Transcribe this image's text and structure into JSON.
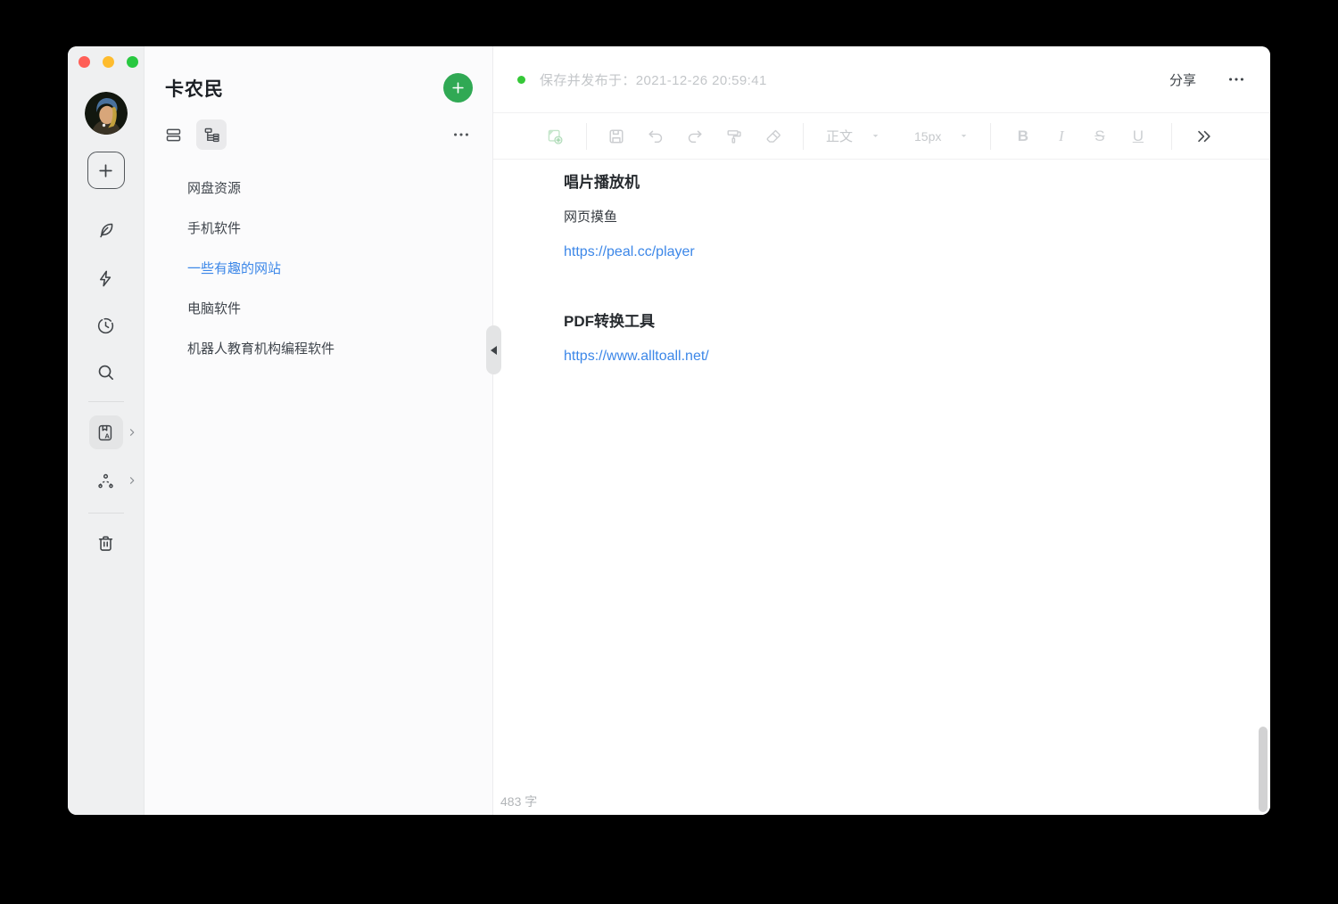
{
  "window": {
    "traffic_colors": {
      "close": "#ff5f57",
      "minimize": "#febc2e",
      "zoom": "#28c840"
    }
  },
  "icon_rail": {
    "icons": [
      {
        "name": "avatar"
      },
      {
        "name": "new-note-icon"
      },
      {
        "name": "pen-icon"
      },
      {
        "name": "flash-icon"
      },
      {
        "name": "recent-icon"
      },
      {
        "name": "search-icon"
      },
      {
        "name": "knowledge-base-icon"
      },
      {
        "name": "team-icon"
      },
      {
        "name": "trash-icon"
      }
    ]
  },
  "doc_sidebar": {
    "title": "卡农民",
    "view_toggles": [
      {
        "name": "list-view",
        "selected": false
      },
      {
        "name": "tree-view",
        "selected": true
      }
    ],
    "items": [
      {
        "label": "网盘资源",
        "active": false
      },
      {
        "label": "手机软件",
        "active": false
      },
      {
        "label": "一些有趣的网站",
        "active": true
      },
      {
        "label": "电脑软件",
        "active": false
      },
      {
        "label": "机器人教育机构编程软件",
        "active": false
      }
    ]
  },
  "editor_header": {
    "status_text": "保存并发布于：2021-12-26 20:59:41",
    "share_label": "分享"
  },
  "toolbar": {
    "paragraph_style": "正文",
    "font_size": "15px",
    "bold_label": "B",
    "italic_label": "I",
    "strike_label": "S",
    "underline_label": "U"
  },
  "content": {
    "heading1": "唱片播放机",
    "para1": "网页摸鱼",
    "link1": "https://peal.cc/player",
    "heading2": "PDF转换工具",
    "link2": "https://www.alltoall.net/"
  },
  "footer": {
    "word_count": "483 字"
  },
  "colors": {
    "accent_green": "#30a954",
    "saved_dot_green": "#35c838",
    "link_blue": "#3c87e8",
    "active_item_blue": "#3c87e8"
  }
}
